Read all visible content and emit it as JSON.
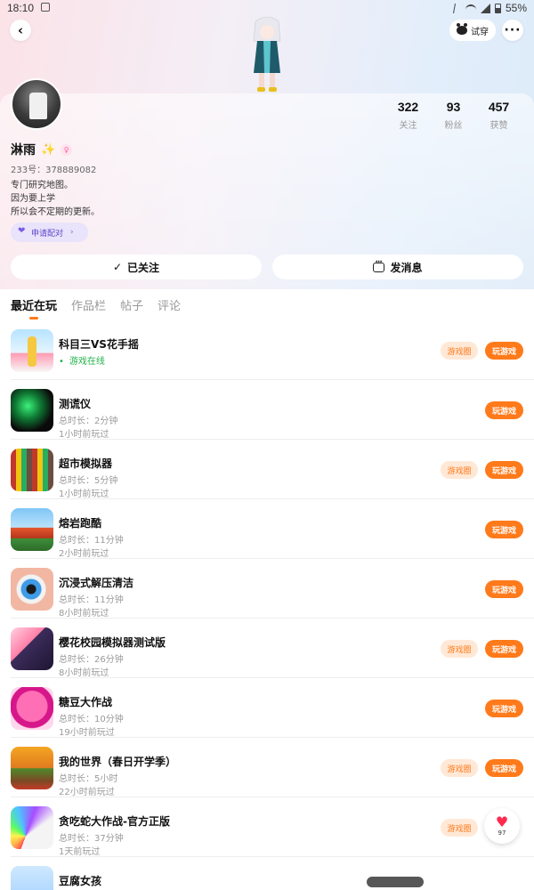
{
  "status_bar": {
    "time": "18:10",
    "battery": "55%"
  },
  "header": {
    "try_label": "试穿"
  },
  "profile": {
    "stats": [
      {
        "num": "322",
        "label": "关注"
      },
      {
        "num": "93",
        "label": "粉丝"
      },
      {
        "num": "457",
        "label": "获赞"
      }
    ],
    "name": "淋雨",
    "uid": "233号：378889082",
    "bio": [
      "专门研究地图。",
      "因为要上学",
      "所以会不定期的更新。"
    ],
    "pair_label": "申请配对",
    "follow_label": "已关注",
    "message_label": "发消息"
  },
  "tabs": [
    "最近在玩",
    "作品栏",
    "帖子",
    "评论"
  ],
  "games": [
    {
      "title": "科目三VS花手摇",
      "line1": "游戏在线",
      "line2": "",
      "circle": "游戏圈",
      "play": "玩游戏"
    },
    {
      "title": "测谎仪",
      "line1": "总时长：2分钟",
      "line2": "1小时前玩过",
      "circle": "",
      "play": "玩游戏"
    },
    {
      "title": "超市模拟器",
      "line1": "总时长：5分钟",
      "line2": "1小时前玩过",
      "circle": "游戏圈",
      "play": "玩游戏"
    },
    {
      "title": "熔岩跑酷",
      "line1": "总时长：11分钟",
      "line2": "2小时前玩过",
      "circle": "",
      "play": "玩游戏"
    },
    {
      "title": "沉浸式解压清洁",
      "line1": "总时长：11分钟",
      "line2": "8小时前玩过",
      "circle": "",
      "play": "玩游戏"
    },
    {
      "title": "樱花校园模拟器测试版",
      "line1": "总时长：26分钟",
      "line2": "8小时前玩过",
      "circle": "游戏圈",
      "play": "玩游戏"
    },
    {
      "title": "糖豆大作战",
      "line1": "总时长：10分钟",
      "line2": "19小时前玩过",
      "circle": "",
      "play": "玩游戏"
    },
    {
      "title": "我的世界（春日开学季）",
      "line1": "总时长：5小时",
      "line2": "22小时前玩过",
      "circle": "游戏圈",
      "play": "玩游戏"
    },
    {
      "title": "贪吃蛇大作战-官方正版",
      "line1": "总时长：37分钟",
      "line2": "1天前玩过",
      "circle": "游戏圈",
      "play": ""
    },
    {
      "title": "豆腐女孩",
      "line1": "",
      "line2": "",
      "circle": "",
      "play": ""
    }
  ],
  "floating_like": {
    "count": "97"
  }
}
